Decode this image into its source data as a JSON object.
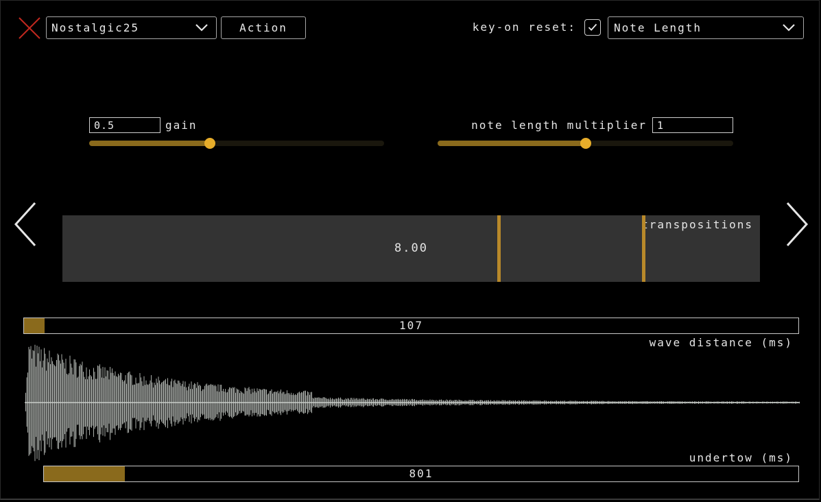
{
  "header": {
    "preset": "Nostalgic25",
    "action_label": "Action",
    "keyon_reset_label": "key-on reset:",
    "keyon_reset_checked": true,
    "mode": "Note Length"
  },
  "gain": {
    "value": "0.5",
    "label": "gain",
    "slider_fraction": 0.41
  },
  "note_length_multiplier": {
    "label": "note length multiplier",
    "value": "1",
    "slider_fraction": 0.5
  },
  "transpositions": {
    "label": "transpositions",
    "value": "8.00",
    "marker_fractions": [
      0.625,
      0.833
    ]
  },
  "wave_distance": {
    "value": "107",
    "label": "wave distance (ms)",
    "fill_fraction": 0.027
  },
  "undertow": {
    "value": "801",
    "label": "undertow (ms)",
    "fill_fraction": 0.107
  },
  "colors": {
    "accent": "#e7ad2a",
    "fill": "#8a6a1c",
    "close": "#c0281f",
    "waveform": "#c8ccc8"
  },
  "icons": {
    "close": "x-icon",
    "prev": "chevron-left-icon",
    "next": "chevron-right-icon"
  }
}
